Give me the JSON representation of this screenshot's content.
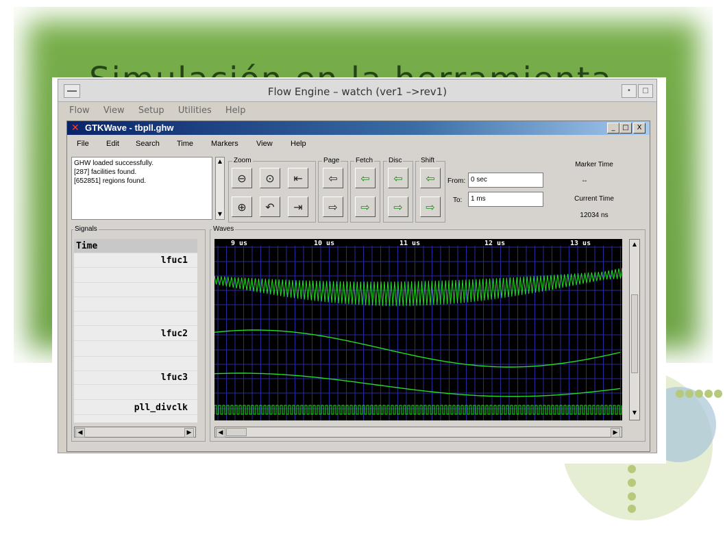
{
  "slide": {
    "title": "Simulación en la herramienta",
    "bg_color": "#72a848"
  },
  "flow_engine": {
    "title": "Flow Engine – watch (ver1 –>rev1)",
    "menu": [
      "Flow",
      "View",
      "Setup",
      "Utilities",
      "Help"
    ]
  },
  "gtkwave": {
    "title": "GTKWave - tbpll.ghw",
    "window_buttons": [
      "_",
      "□",
      "X"
    ],
    "menu": [
      "File",
      "Edit",
      "Search",
      "Time",
      "Markers",
      "View",
      "Help"
    ],
    "messages": [
      "GHW loaded successfully.",
      "[287] facilities found.",
      "[652851] regions found."
    ],
    "groups": {
      "zoom": "Zoom",
      "page": "Page",
      "fetch": "Fetch",
      "disc": "Disc",
      "shift": "Shift"
    },
    "from_label": "From:",
    "from_value": "0 sec",
    "to_label": "To:",
    "to_value": "1 ms",
    "marker_time_label": "Marker Time",
    "marker_time_value": "--",
    "current_time_label": "Current Time",
    "current_time_value": "12034 ns",
    "signals_label": "Signals",
    "waves_label": "Waves",
    "signal_header": "Time",
    "signals": [
      "lfuc1",
      "lfuc2",
      "lfuc3",
      "pll_divclk"
    ],
    "time_ticks": [
      "9 us",
      "10 us",
      "11 us",
      "12 us",
      "13 us"
    ],
    "wave_color": "#22e022",
    "grid_color": "#2a2aa0"
  }
}
